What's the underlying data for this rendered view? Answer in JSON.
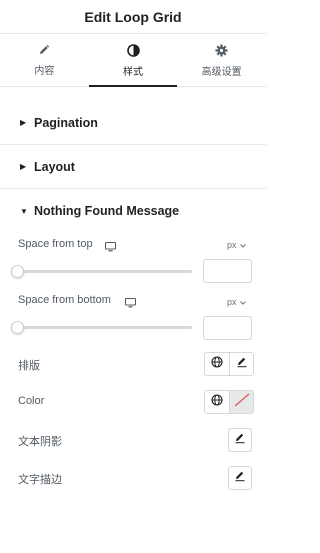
{
  "header": {
    "title": "Edit Loop Grid"
  },
  "tabs": [
    {
      "label": "内容",
      "icon": "pencil-icon"
    },
    {
      "label": "样式",
      "icon": "half-circle-icon",
      "active": true
    },
    {
      "label": "高级设置",
      "icon": "gear-icon"
    }
  ],
  "sections": {
    "pagination": {
      "title": "Pagination",
      "expanded": false
    },
    "layout": {
      "title": "Layout",
      "expanded": false
    },
    "nothing_found": {
      "title": "Nothing Found Message",
      "expanded": true
    }
  },
  "controls": {
    "space_top": {
      "label": "Space from top",
      "unit": "px",
      "value": "",
      "slider_level": 0
    },
    "space_bottom": {
      "label": "Space from bottom",
      "unit": "px",
      "value": "",
      "slider_level": 0
    },
    "typography": {
      "label": "排版"
    },
    "color": {
      "label": "Color"
    },
    "text_shadow": {
      "label": "文本阴影"
    },
    "text_stroke": {
      "label": "文字描边"
    }
  },
  "colors": {
    "accent": "#1f2124",
    "border": "#d5d8dc",
    "clear_swatch": "#e05a5a"
  }
}
